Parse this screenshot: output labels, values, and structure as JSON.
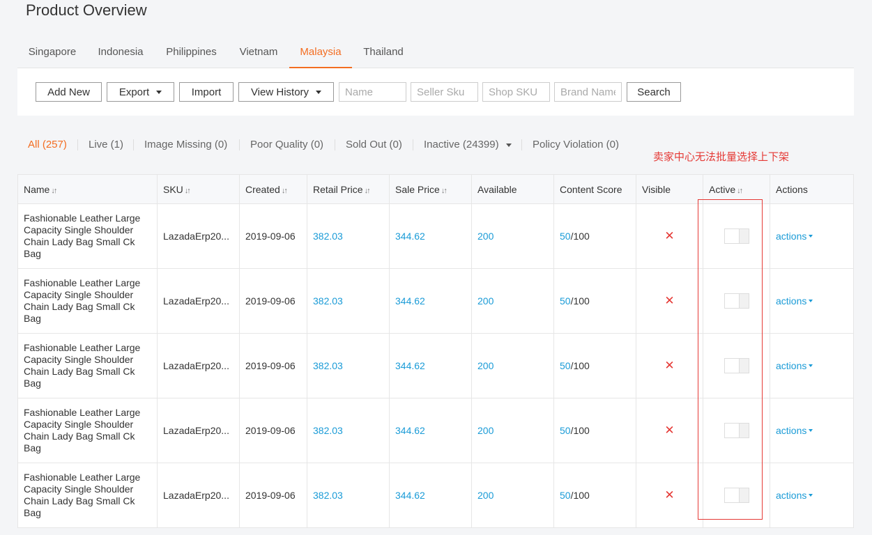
{
  "page": {
    "title": "Product Overview"
  },
  "tabs": [
    {
      "label": "Singapore"
    },
    {
      "label": "Indonesia"
    },
    {
      "label": "Philippines"
    },
    {
      "label": "Vietnam"
    },
    {
      "label": "Malaysia"
    },
    {
      "label": "Thailand"
    }
  ],
  "active_tab": "Malaysia",
  "toolbar": {
    "add_new": "Add New",
    "export": "Export",
    "import": "Import",
    "view_history": "View History",
    "name_placeholder": "Name",
    "seller_sku_placeholder": "Seller Sku",
    "shop_sku_placeholder": "Shop SKU",
    "brand_name_placeholder": "Brand Name",
    "search": "Search"
  },
  "filters": [
    {
      "label": "All (257)"
    },
    {
      "label": "Live (1)"
    },
    {
      "label": "Image Missing (0)"
    },
    {
      "label": "Poor Quality (0)"
    },
    {
      "label": "Sold Out (0)"
    },
    {
      "label": "Inactive (24399)"
    },
    {
      "label": "Policy Violation (0)"
    }
  ],
  "annotation": "卖家中心无法批量选择上下架",
  "table": {
    "headers": {
      "name": "Name",
      "sku": "SKU",
      "created": "Created",
      "retail_price": "Retail Price",
      "sale_price": "Sale Price",
      "available": "Available",
      "content_score": "Content Score",
      "visible": "Visible",
      "active": "Active",
      "actions": "Actions"
    },
    "sort_icon": "↓↑",
    "rows": [
      {
        "name": "Fashionable Leather Large Capacity Single Shoulder Chain Lady Bag Small Ck Bag",
        "sku": "LazadaErp20...",
        "created": "2019-09-06",
        "retail_price": "382.03",
        "sale_price": "344.62",
        "available": "200",
        "score": "50",
        "score_max": "/100",
        "visible_icon": "✕",
        "actions": "actions"
      },
      {
        "name": "Fashionable Leather Large Capacity Single Shoulder Chain Lady Bag Small Ck Bag",
        "sku": "LazadaErp20...",
        "created": "2019-09-06",
        "retail_price": "382.03",
        "sale_price": "344.62",
        "available": "200",
        "score": "50",
        "score_max": "/100",
        "visible_icon": "✕",
        "actions": "actions"
      },
      {
        "name": "Fashionable Leather Large Capacity Single Shoulder Chain Lady Bag Small Ck Bag",
        "sku": "LazadaErp20...",
        "created": "2019-09-06",
        "retail_price": "382.03",
        "sale_price": "344.62",
        "available": "200",
        "score": "50",
        "score_max": "/100",
        "visible_icon": "✕",
        "actions": "actions"
      },
      {
        "name": "Fashionable Leather Large Capacity Single Shoulder Chain Lady Bag Small Ck Bag",
        "sku": "LazadaErp20...",
        "created": "2019-09-06",
        "retail_price": "382.03",
        "sale_price": "344.62",
        "available": "200",
        "score": "50",
        "score_max": "/100",
        "visible_icon": "✕",
        "actions": "actions"
      },
      {
        "name": "Fashionable Leather Large Capacity Single Shoulder Chain Lady Bag Small Ck Bag",
        "sku": "LazadaErp20...",
        "created": "2019-09-06",
        "retail_price": "382.03",
        "sale_price": "344.62",
        "available": "200",
        "score": "50",
        "score_max": "/100",
        "visible_icon": "✕",
        "actions": "actions"
      }
    ]
  },
  "colors": {
    "accent": "#f36d21",
    "link": "#1a9bd7",
    "error": "#e53935"
  }
}
